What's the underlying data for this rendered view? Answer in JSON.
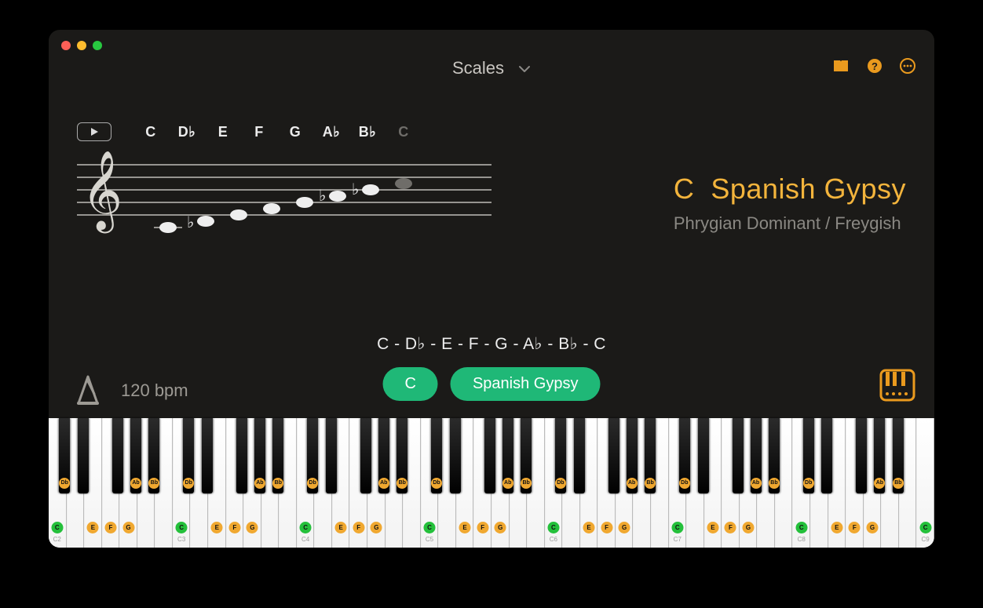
{
  "header": {
    "dropdown_label": "Scales"
  },
  "notation": {
    "note_labels": [
      "C",
      "D♭",
      "E",
      "F",
      "G",
      "A♭",
      "B♭",
      "C"
    ]
  },
  "title": {
    "root": "C",
    "name": "Spanish Gypsy",
    "subtitle": "Phrygian Dominant / Freygish"
  },
  "center": {
    "scale_text": "C - D♭ - E - F - G - A♭ - B♭ - C",
    "pill_root": "C",
    "pill_scale": "Spanish Gypsy"
  },
  "metronome": {
    "tempo_label": "120 bpm"
  },
  "piano": {
    "root_note": "C",
    "white_marks": {
      "C": {
        "label": "C",
        "type": "root"
      },
      "E": {
        "label": "E",
        "type": "scale"
      },
      "F": {
        "label": "F",
        "type": "scale"
      },
      "G": {
        "label": "G",
        "type": "scale"
      }
    },
    "black_marks": {
      "Db": "Db",
      "Ab": "Ab",
      "Bb": "Bb"
    },
    "octaves": [
      2,
      3,
      4,
      5,
      6,
      7,
      8
    ],
    "octave_prefix": "C"
  },
  "colors": {
    "accent": "#ea9a1e",
    "pill": "#1fb877",
    "root_mark": "#24c03b",
    "scale_mark": "#f0a830"
  }
}
